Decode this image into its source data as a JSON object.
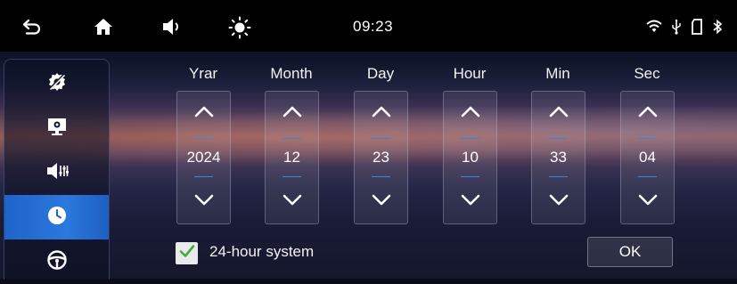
{
  "status_bar": {
    "time": "09:23",
    "icons": [
      "back-icon",
      "home-icon",
      "volume-icon",
      "brightness-icon",
      "wifi-icon",
      "usb-icon",
      "sd-card-icon",
      "bluetooth-icon"
    ]
  },
  "sidebar": {
    "items": [
      {
        "icon": "settings-off-icon",
        "active": false
      },
      {
        "icon": "display-settings-icon",
        "active": false
      },
      {
        "icon": "sound-settings-icon",
        "active": false
      },
      {
        "icon": "clock-icon",
        "active": true
      },
      {
        "icon": "steering-wheel-icon",
        "active": false
      }
    ]
  },
  "datetime": {
    "columns": [
      {
        "label": "Yrar",
        "value": "2024"
      },
      {
        "label": "Month",
        "value": "12"
      },
      {
        "label": "Day",
        "value": "23"
      },
      {
        "label": "Hour",
        "value": "10"
      },
      {
        "label": "Min",
        "value": "33"
      },
      {
        "label": "Sec",
        "value": "04"
      }
    ]
  },
  "bottom": {
    "checkbox_label": "24-hour system",
    "checkbox_checked": true,
    "ok_label": "OK"
  },
  "colors": {
    "accent": "#2b78de",
    "check": "#3fae3a",
    "divider": "#3b86d6"
  }
}
